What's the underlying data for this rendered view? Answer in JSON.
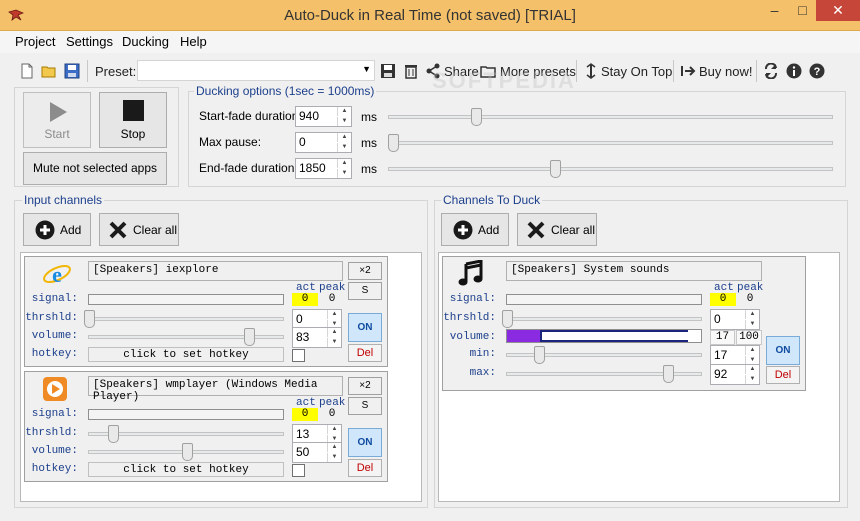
{
  "window": {
    "title": "Auto-Duck in Real Time (not saved) [TRIAL]",
    "minimize_glyph": "–",
    "maximize_glyph": "□",
    "close_glyph": "✕"
  },
  "menu": [
    "Project",
    "Settings",
    "Ducking",
    "Help"
  ],
  "toolbar": {
    "preset_label": "Preset:",
    "preset_value": "",
    "share_label": "Share",
    "more_presets_label": "More presets",
    "stay_on_top_label": "Stay On Top",
    "buy_now_label": "Buy now!"
  },
  "watermark": "SOFTPEDIA",
  "controls": {
    "start_label": "Start",
    "stop_label": "Stop",
    "mute_label": "Mute not selected apps"
  },
  "ducking_options": {
    "title": "Ducking options (1sec = 1000ms)",
    "unit": "ms",
    "start_fade": {
      "label": "Start-fade duration:",
      "value": "940",
      "slider_fraction": 0.19
    },
    "max_pause": {
      "label": "Max pause:",
      "value": "0",
      "slider_fraction": 0.0
    },
    "end_fade": {
      "label": "End-fade duration:",
      "value": "1850",
      "slider_fraction": 0.37
    }
  },
  "input_channels": {
    "title": "Input channels",
    "add_label": "Add",
    "clear_label": "Clear all",
    "items": [
      {
        "name": "[Speakers] iexplore",
        "act_label": "act",
        "peak_label": "peak",
        "act": "0",
        "peak": "0",
        "signal_label": "signal:",
        "threshold_label": "thrshld:",
        "threshold": "0",
        "threshold_fraction": 0.0,
        "volume_label": "volume:",
        "volume": "83",
        "volume_fraction": 0.83,
        "hotkey_label": "hotkey:",
        "hotkey_text": "click to set hotkey",
        "x2_label": "×2",
        "s_label": "S",
        "on_label": "ON",
        "del_label": "Del"
      },
      {
        "name": "[Speakers] wmplayer (Windows Media Player)",
        "act_label": "act",
        "peak_label": "peak",
        "act": "0",
        "peak": "0",
        "signal_label": "signal:",
        "threshold_label": "thrshld:",
        "threshold": "13",
        "threshold_fraction": 0.13,
        "volume_label": "volume:",
        "volume": "50",
        "volume_fraction": 0.5,
        "hotkey_label": "hotkey:",
        "hotkey_text": "click to set hotkey",
        "x2_label": "×2",
        "s_label": "S",
        "on_label": "ON",
        "del_label": "Del"
      }
    ]
  },
  "channels_to_duck": {
    "title": "Channels To Duck",
    "add_label": "Add",
    "clear_label": "Clear all",
    "items": [
      {
        "name": "[Speakers] System sounds",
        "act_label": "act",
        "peak_label": "peak",
        "act": "0",
        "peak": "0",
        "signal_label": "signal:",
        "threshold_label": "thrshld:",
        "threshold": "0",
        "threshold_fraction": 0.0,
        "volume_label": "volume:",
        "volume_current": "17",
        "volume_max": "100",
        "volume_fill_fraction": 0.17,
        "min_label": "min:",
        "min": "17",
        "min_fraction": 0.17,
        "max_label": "max:",
        "max": "92",
        "max_fraction": 0.92,
        "on_label": "ON",
        "del_label": "Del"
      }
    ]
  },
  "colors": {
    "titlebar": "#f4c069",
    "close_button": "#c7463a",
    "label_blue": "#1c3f8c",
    "meter_yellow": "#ffff00",
    "volume_purple": "#8a2be2",
    "on_button": "#cfe6fb"
  },
  "icons": [
    "app-icon",
    "new-file-icon",
    "open-folder-icon",
    "save-icon",
    "delete-icon",
    "share-icon",
    "more-presets-icon",
    "pin-icon",
    "arrow-right-icon",
    "refresh-icon",
    "info-icon",
    "help-icon",
    "play-icon",
    "stop-icon",
    "plus-icon",
    "x-icon",
    "ie-icon",
    "wmp-icon",
    "music-note-icon"
  ]
}
